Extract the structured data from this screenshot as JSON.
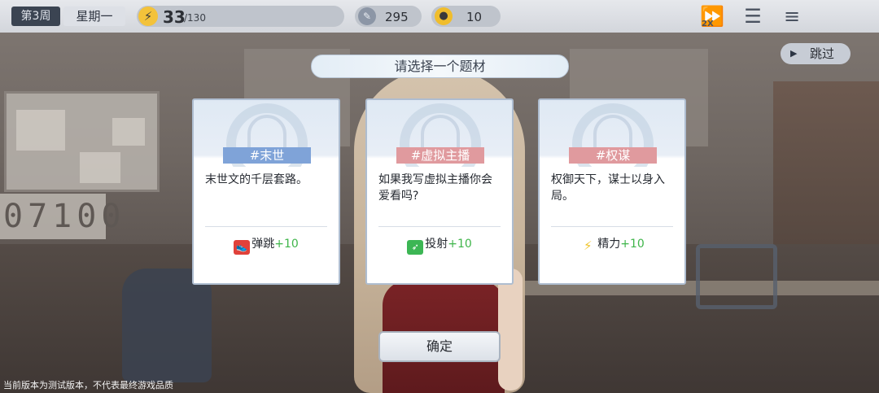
{
  "topbar": {
    "week": "第3周",
    "weekday": "星期一",
    "energy": "33",
    "energy_max": "/130",
    "coins": "295",
    "ideas": "10",
    "speed_label": "2X"
  },
  "skip_label": "跳过",
  "title": "请选择一个题材",
  "cards": [
    {
      "tag": "#末世",
      "tag_color": "#7fa3d8",
      "description": "末世文的千层套路。",
      "reward_stat": "弹跳",
      "reward_value": "+10",
      "reward_icon": "running-shoe-icon",
      "reward_icon_color": "#e0413a"
    },
    {
      "tag": "#虚拟主播",
      "tag_color": "#e09a9e",
      "description": "如果我写虚拟主播你会爱看吗?",
      "reward_stat": "投射",
      "reward_value": "+10",
      "reward_icon": "throw-ball-icon",
      "reward_icon_color": "#3cb654"
    },
    {
      "tag": "#权谋",
      "tag_color": "#e09a9e",
      "description": "权御天下，谋士以身入局。",
      "reward_stat": "精力",
      "reward_value": "+10",
      "reward_icon": "lightning-icon",
      "reward_icon_color": "#f0c52c"
    }
  ],
  "confirm_label": "确定",
  "footnote": "当前版本为测试版本，不代表最终游戏品质"
}
